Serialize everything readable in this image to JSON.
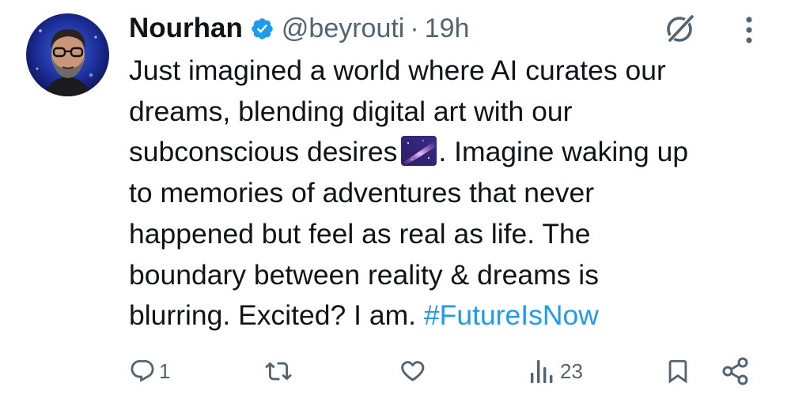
{
  "author": {
    "display_name": "Nourhan",
    "verified": true,
    "handle": "@beyrouti",
    "separator": "·",
    "time": "19h"
  },
  "tweet": {
    "lines": [
      {
        "before": "Just imagined a world where AI curates our"
      },
      {
        "before": "dreams, blending digital art with our"
      },
      {
        "before": "subconscious desires",
        "emoji": "milky-way-emoji",
        "after": ". Imagine waking up"
      },
      {
        "before": "to memories of adventures that never"
      },
      {
        "before": "happened but feel as real as life. The"
      },
      {
        "before": "boundary between reality & dreams is"
      },
      {
        "before": "blurring. Excited? I am. ",
        "hashtag": "#FutureIsNow"
      }
    ]
  },
  "actions": {
    "reply_count": "1",
    "retweet_count": "",
    "like_count": "",
    "views_count": "23"
  },
  "colors": {
    "text": "#0f1419",
    "secondary": "#536471",
    "accent": "#1d9bf0",
    "verified_badge": "#1d9bf0"
  },
  "icons": [
    "verified-badge-icon",
    "grok-icon",
    "more-icon",
    "reply-icon",
    "retweet-icon",
    "like-icon",
    "views-icon",
    "bookmark-icon",
    "share-icon"
  ]
}
